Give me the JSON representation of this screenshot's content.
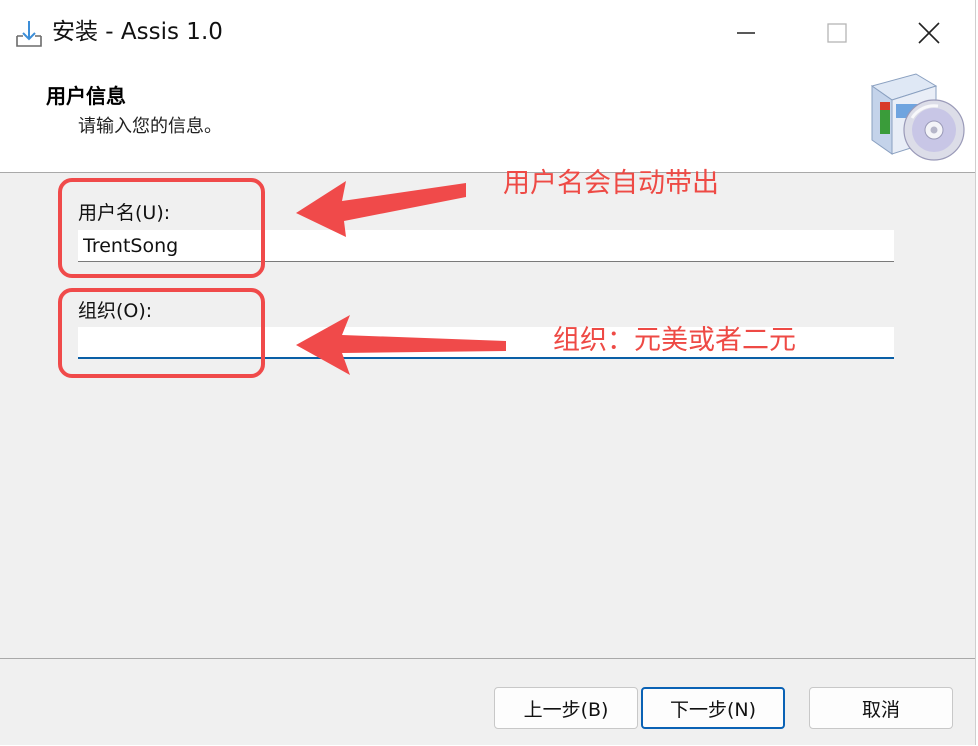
{
  "window": {
    "title": "安装 - Assis 1.0"
  },
  "header": {
    "title": "用户信息",
    "subtitle": "请输入您的信息。"
  },
  "form": {
    "username_label": "用户名(U):",
    "username_value": "TrentSong",
    "org_label": "组织(O):",
    "org_value": ""
  },
  "annotations": {
    "username_note": "用户名会自动带出",
    "org_note": "组织：元美或者二元",
    "color": "#f04a4a"
  },
  "buttons": {
    "back": "上一步(B)",
    "next": "下一步(N)",
    "cancel": "取消"
  },
  "icons": [
    "installer-download-icon",
    "minimize-icon",
    "maximize-icon",
    "close-icon",
    "software-box-cd-icon"
  ],
  "colors": {
    "accent": "#0a62b5",
    "panel": "#f0f0f0"
  }
}
